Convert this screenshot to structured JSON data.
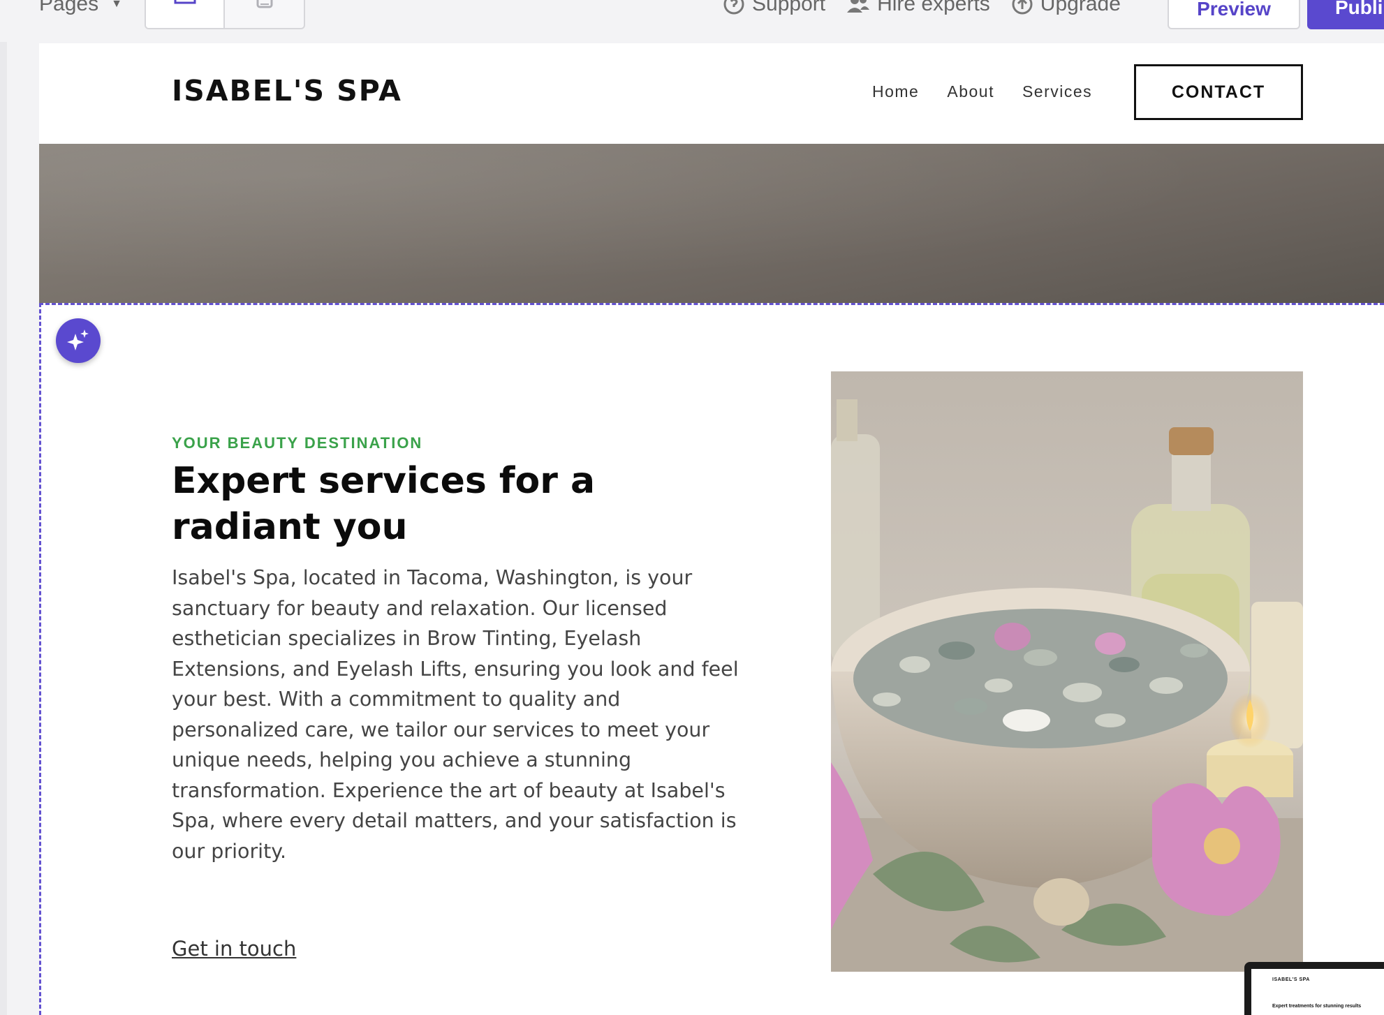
{
  "toolbar": {
    "pages_label": "Pages",
    "support_label": "Support",
    "hire_label": "Hire experts",
    "upgrade_label": "Upgrade",
    "preview_label": "Preview",
    "publish_label": "Publi"
  },
  "site": {
    "logo": "ISABEL'S SPA",
    "nav": [
      "Home",
      "About",
      "Services"
    ],
    "contact_label": "CONTACT"
  },
  "hero": {
    "eyebrow": "YOUR BEAUTY DESTINATION",
    "headline": "Expert services for a radiant you",
    "body": "Isabel's Spa, located in Tacoma, Washington, is your sanctuary for beauty and relaxation. Our licensed esthetician specializes in Brow Tinting, Eyelash Extensions, and Eyelash Lifts, ensuring you look and feel your best. With a commitment to quality and personalized care, we tailor our services to meet your unique needs, helping you achieve a stunning transformation. Experience the art of beauty at Isabel's Spa, where every detail matters, and your satisfaction is our priority.",
    "link": "Get in touch"
  },
  "mini_preview": {
    "logo": "ISABEL'S SPA",
    "headline": "Expert treatments for stunning results"
  },
  "colors": {
    "accent": "#5a49cf",
    "eyebrow_green": "#3aa24a"
  }
}
